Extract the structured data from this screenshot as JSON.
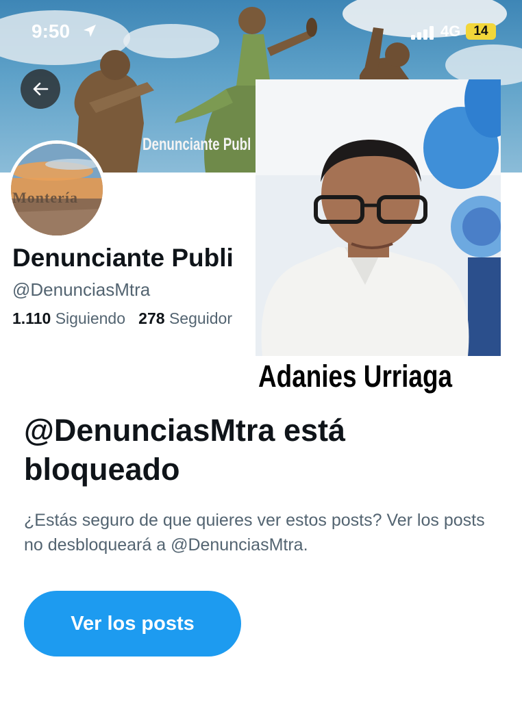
{
  "status_bar": {
    "time": "9:50",
    "network": "4G",
    "battery": "14",
    "icons": [
      "location-arrow-icon",
      "signal-icon"
    ]
  },
  "header": {
    "banner_text": "Denunciante Publ",
    "back_icon": "arrow-left-icon"
  },
  "avatar": {
    "text": "Montería"
  },
  "profile": {
    "name": "Denunciante Publi",
    "handle": "@DenunciasMtra",
    "following_count": "1.110",
    "following_label": "Siguiendo",
    "followers_count": "278",
    "followers_label": "Seguidor"
  },
  "overlay": {
    "caption": "Adanies Urriaga"
  },
  "blocked": {
    "title": "@DenunciasMtra está bloqueado",
    "description": "¿Estás seguro de que quieres ver estos posts? Ver los posts no desbloqueará a @DenunciasMtra.",
    "button_label": "Ver los posts"
  },
  "colors": {
    "accent": "#1d9bf0",
    "text_primary": "#0f1419",
    "text_secondary": "#536471"
  }
}
